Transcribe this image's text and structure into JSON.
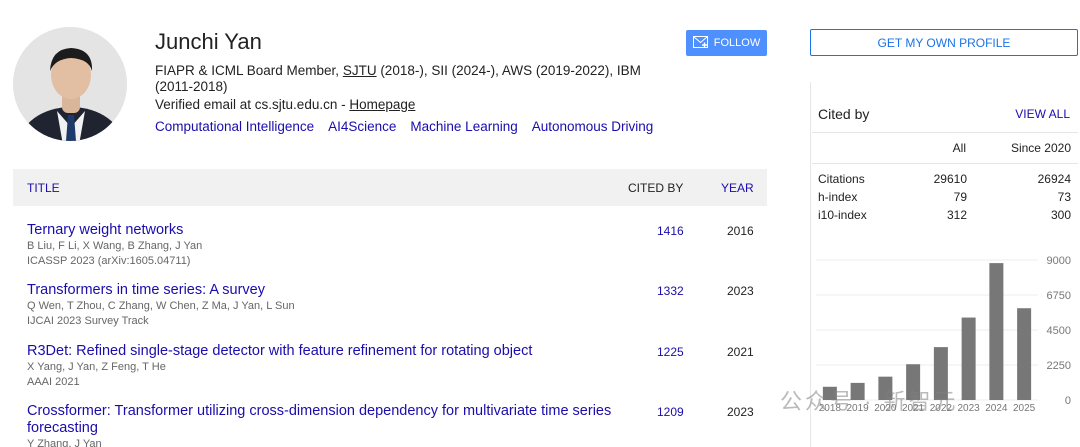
{
  "profile": {
    "name": "Junchi Yan",
    "affiliation_prefix": "FIAPR & ICML Board Member, ",
    "affiliation_link": "SJTU",
    "affiliation_suffix": " (2018-), SII (2024-), AWS (2019-2022), IBM (2011-2018)",
    "email_text": "Verified email at cs.sjtu.edu.cn - ",
    "homepage_link": "Homepage",
    "interests": [
      "Computational Intelligence",
      "AI4Science",
      "Machine Learning",
      "Autonomous Driving"
    ],
    "follow_label": "FOLLOW"
  },
  "table": {
    "col_title": "TITLE",
    "col_cited": "CITED BY",
    "col_year": "YEAR",
    "articles": [
      {
        "title": "Ternary weight networks",
        "authors": "B Liu, F Li, X Wang, B Zhang, J Yan",
        "venue": "ICASSP 2023 (arXiv:1605.04711)",
        "cited_by": "1416",
        "year": "2016"
      },
      {
        "title": "Transformers in time series: A survey",
        "authors": "Q Wen, T Zhou, C Zhang, W Chen, Z Ma, J Yan, L Sun",
        "venue": "IJCAI 2023 Survey Track",
        "cited_by": "1332",
        "year": "2023"
      },
      {
        "title": "R3Det: Refined single-stage detector with feature refinement for rotating object",
        "authors": "X Yang, J Yan, Z Feng, T He",
        "venue": "AAAI 2021",
        "cited_by": "1225",
        "year": "2021"
      },
      {
        "title": "Crossformer: Transformer utilizing cross-dimension dependency for multivariate time series forecasting",
        "authors": "Y Zhang, J Yan",
        "venue": "",
        "cited_by": "1209",
        "year": "2023"
      }
    ]
  },
  "sidebar": {
    "own_profile_label": "GET MY OWN PROFILE",
    "cited_by_title": "Cited by",
    "view_all_label": "VIEW ALL",
    "col_all": "All",
    "col_since": "Since 2020",
    "metrics": [
      {
        "label": "Citations",
        "all": "29610",
        "since": "26924"
      },
      {
        "label": "h-index",
        "all": "79",
        "since": "73"
      },
      {
        "label": "i10-index",
        "all": "312",
        "since": "300"
      }
    ]
  },
  "chart_data": {
    "type": "bar",
    "categories": [
      "2018",
      "2019",
      "2020",
      "2021",
      "2022",
      "2023",
      "2024",
      "2025"
    ],
    "values": [
      850,
      1100,
      1500,
      2300,
      3400,
      5300,
      8800,
      5900
    ],
    "y_ticks": [
      "9000",
      "6750",
      "4500",
      "2250",
      "0"
    ],
    "ylim": [
      0,
      9000
    ],
    "bar_color": "#777777",
    "grid": true
  },
  "watermark": "公众号 · 新智元"
}
